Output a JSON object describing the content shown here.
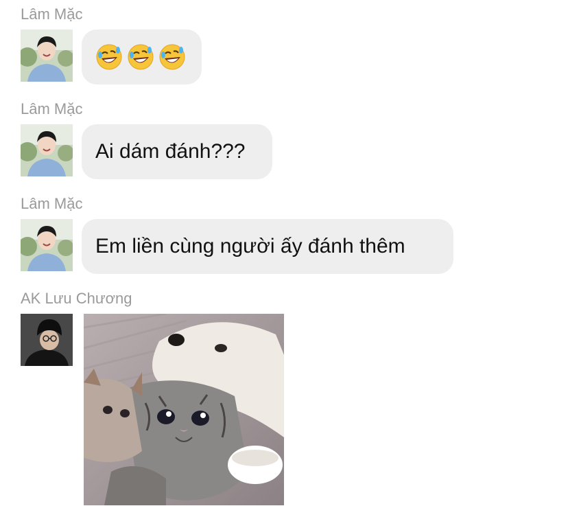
{
  "messages": [
    {
      "sender": "Lâm Mặc",
      "text": "",
      "emoji": [
        "rolling-on-floor-laughing",
        "rolling-on-floor-laughing",
        "rolling-on-floor-laughing"
      ]
    },
    {
      "sender": "Lâm Mặc",
      "text": "Ai dám đánh???"
    },
    {
      "sender": "Lâm Mặc",
      "text": "Em liền cùng người ấy đánh thêm"
    },
    {
      "sender": "AK Lưu Chương",
      "text": "",
      "image": "crying-cat-with-dog-meme"
    }
  ],
  "colors": {
    "bubble_bg": "#eeeeee",
    "sender_text": "#9a9a9a",
    "message_text": "#111111",
    "background": "#ffffff"
  }
}
